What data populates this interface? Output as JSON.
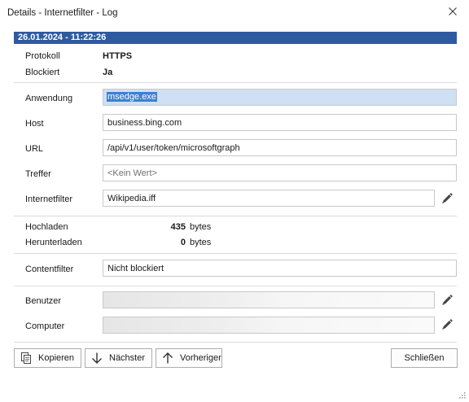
{
  "window": {
    "title": "Details - Internetfilter - Log"
  },
  "header": {
    "datetime": "26.01.2024 - 11:22:26"
  },
  "info": {
    "protokoll_label": "Protokoll",
    "protokoll_value": "HTTPS",
    "blockiert_label": "Blockiert",
    "blockiert_value": "Ja"
  },
  "fields": {
    "anwendung_label": "Anwendung",
    "anwendung_value": "msedge.exe",
    "host_label": "Host",
    "host_value": "business.bing.com",
    "url_label": "URL",
    "url_value": "/api/v1/user/token/microsoftgraph",
    "treffer_label": "Treffer",
    "treffer_placeholder": "<Kein Wert>",
    "internetfilter_label": "Internetfilter",
    "internetfilter_value": "Wikipedia.iff"
  },
  "traffic": {
    "hochladen_label": "Hochladen",
    "hochladen_value": "435",
    "herunterladen_label": "Herunterladen",
    "herunterladen_value": "0",
    "unit": "bytes"
  },
  "content": {
    "contentfilter_label": "Contentfilter",
    "contentfilter_value": "Nicht blockiert"
  },
  "user": {
    "benutzer_label": "Benutzer",
    "computer_label": "Computer"
  },
  "buttons": {
    "kopieren": "Kopieren",
    "naechster": "Nächster",
    "vorheriger": "Vorheriger",
    "schliessen": "Schließen"
  },
  "colors": {
    "header_bg": "#2e5aa0",
    "selection_bg": "#cfe0f5",
    "selection_text_bg": "#3f7fd0"
  },
  "icons": [
    "close-icon",
    "pencil-icon",
    "copy-icon",
    "arrow-down-icon",
    "arrow-up-icon",
    "resize-grip-icon"
  ]
}
